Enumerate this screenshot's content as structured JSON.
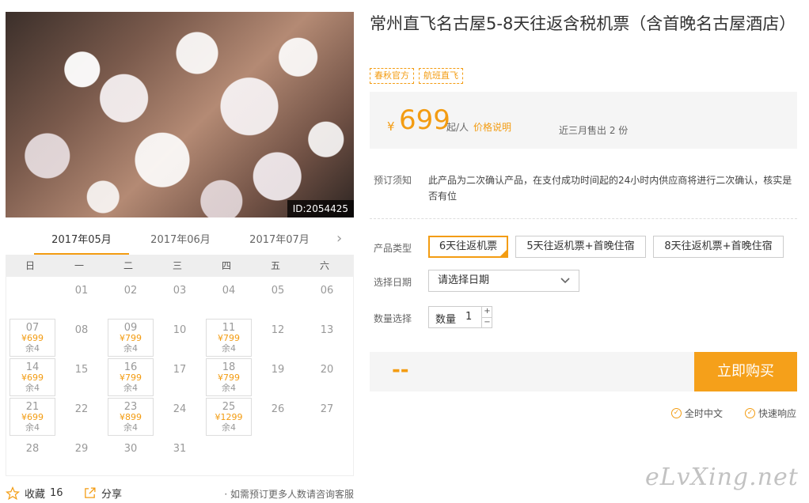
{
  "product": {
    "title": "常州直飞名古屋5-8天往返含税机票（含首晚名古屋酒店）",
    "tags": [
      "春秋官方",
      "航班直飞"
    ],
    "image_id": "ID:2054425"
  },
  "price": {
    "currency": "¥",
    "value": "699",
    "unit": "起/人",
    "note": "价格说明",
    "sold": "近三月售出 2 份"
  },
  "notice": {
    "label": "预订须知",
    "text": "此产品为二次确认产品，在支付成功时间起的24小时内供应商将进行二次确认，核实是否有位"
  },
  "product_type": {
    "label": "产品类型",
    "options": [
      "6天往返机票",
      "5天往返机票+首晚住宿",
      "8天往返机票+首晚住宿"
    ],
    "selected_index": 0
  },
  "date": {
    "label": "选择日期",
    "placeholder": "请选择日期"
  },
  "quantity": {
    "label": "数量选择",
    "field_label": "数量",
    "value": "1",
    "plus": "+",
    "minus": "−"
  },
  "buy": {
    "total": "--",
    "button": "立即购买"
  },
  "services": [
    "全时中文",
    "快速响应"
  ],
  "calendar": {
    "tabs": [
      "2017年05月",
      "2017年06月",
      "2017年07月"
    ],
    "active_tab": 0,
    "weekdays": [
      "日",
      "一",
      "二",
      "三",
      "四",
      "五",
      "六"
    ],
    "rows": [
      [
        {
          "d": ""
        },
        {
          "d": "01"
        },
        {
          "d": "02"
        },
        {
          "d": "03"
        },
        {
          "d": "04"
        },
        {
          "d": "05"
        },
        {
          "d": "06"
        }
      ],
      [
        {
          "d": "07",
          "p": "¥699",
          "s": "余4"
        },
        {
          "d": "08"
        },
        {
          "d": "09",
          "p": "¥799",
          "s": "余4"
        },
        {
          "d": "10"
        },
        {
          "d": "11",
          "p": "¥799",
          "s": "余4"
        },
        {
          "d": "12"
        },
        {
          "d": "13"
        }
      ],
      [
        {
          "d": "14",
          "p": "¥699",
          "s": "余4"
        },
        {
          "d": "15"
        },
        {
          "d": "16",
          "p": "¥799",
          "s": "余4"
        },
        {
          "d": "17"
        },
        {
          "d": "18",
          "p": "¥799",
          "s": "余4"
        },
        {
          "d": "19"
        },
        {
          "d": "20"
        }
      ],
      [
        {
          "d": "21",
          "p": "¥699",
          "s": "余4"
        },
        {
          "d": "22"
        },
        {
          "d": "23",
          "p": "¥899",
          "s": "余4"
        },
        {
          "d": "24"
        },
        {
          "d": "25",
          "p": "¥1299",
          "s": "余4"
        },
        {
          "d": "26"
        },
        {
          "d": "27"
        }
      ],
      [
        {
          "d": "28"
        },
        {
          "d": "29"
        },
        {
          "d": "30"
        },
        {
          "d": "31"
        },
        {
          "d": ""
        },
        {
          "d": ""
        },
        {
          "d": ""
        }
      ]
    ]
  },
  "footer": {
    "favorite_label": "收藏",
    "favorite_count": "16",
    "share_label": "分享",
    "consult": "· 如需预订更多人数请咨询客服"
  },
  "watermark": "eLvXing.net",
  "colors": {
    "accent": "#f39c12",
    "buy_button": "#f5a01a"
  }
}
